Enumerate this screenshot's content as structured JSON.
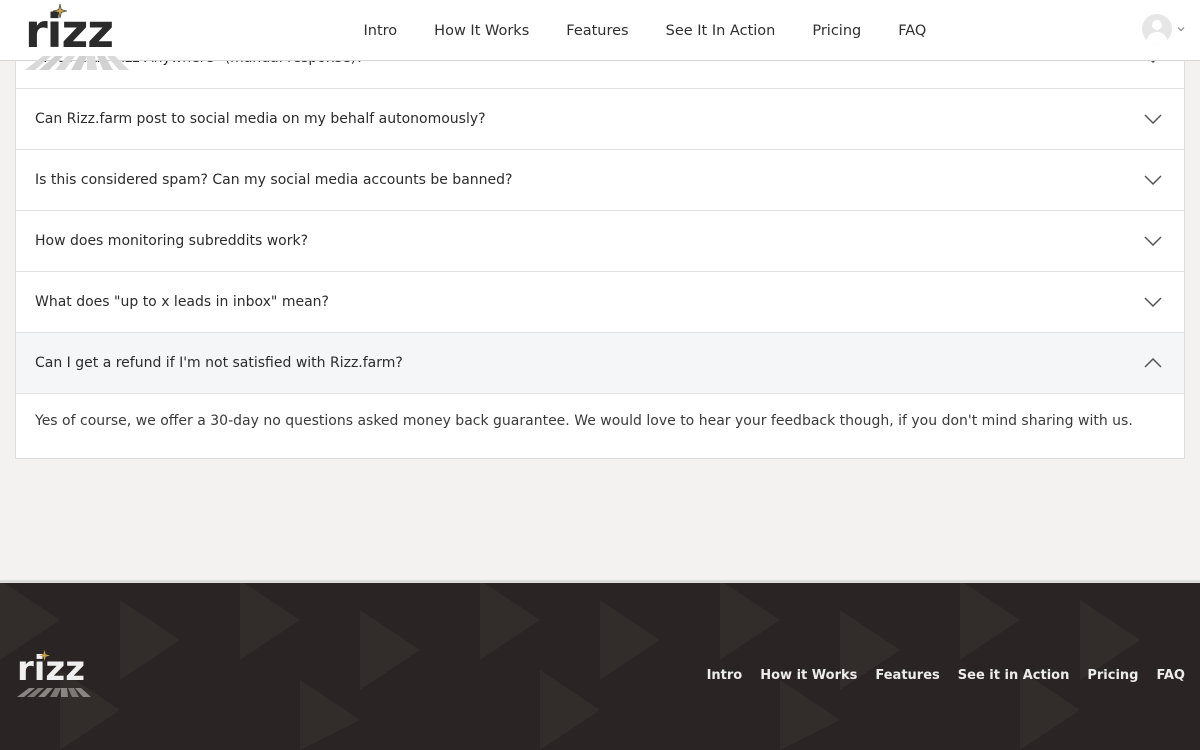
{
  "header": {
    "logo_text": "rizz",
    "nav": [
      "Intro",
      "How It Works",
      "Features",
      "See It In Action",
      "Pricing",
      "FAQ"
    ]
  },
  "faq": {
    "items": [
      {
        "question": "What is a \"Rizz Anywhere\" (manual response)?",
        "open": false
      },
      {
        "question": "Can Rizz.farm post to social media on my behalf autonomously?",
        "open": false
      },
      {
        "question": "Is this considered spam? Can my social media accounts be banned?",
        "open": false
      },
      {
        "question": "How does monitoring subreddits work?",
        "open": false
      },
      {
        "question": "What does \"up to x leads in inbox\" mean?",
        "open": false
      },
      {
        "question": "Can I get a refund if I'm not satisfied with Rizz.farm?",
        "open": true
      }
    ],
    "answer": "Yes of course, we offer a 30-day no questions asked money back guarantee. We would love to hear your feedback though, if you don't mind sharing with us."
  },
  "footer": {
    "logo_text": "rizz",
    "nav": [
      "Intro",
      "How it Works",
      "Features",
      "See it in Action",
      "Pricing",
      "FAQ"
    ]
  },
  "colors": {
    "header_bg": "#ffffff",
    "page_bg": "#f3f2f1",
    "footer_bg": "#2a2524",
    "logo_star": "#c9a24a"
  }
}
